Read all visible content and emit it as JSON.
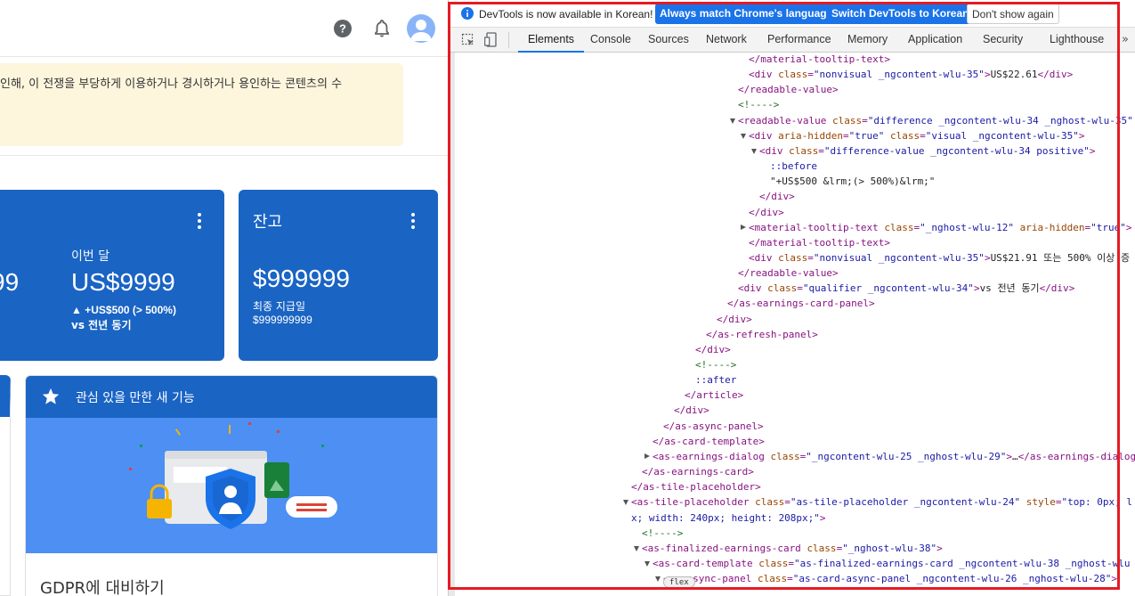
{
  "page": {
    "notice_text": "인해, 이 전쟁을 부당하게 이용하거나 경시하거나 용인하는 콘텐츠의 수",
    "cards": {
      "month": {
        "partial_value": "99",
        "partial_sub": ")",
        "label": "이번 달",
        "value": "US$9999",
        "change": "▲ +US$500 (> 500%)",
        "compare": "vs 전년 동기"
      },
      "balance": {
        "title": "잔고",
        "value": "$999999",
        "paid_label": "최종 지급일",
        "paid_value": "$999999999"
      }
    },
    "feature": {
      "title": "관심 있을 만한 새 기능",
      "subtitle": "GDPR에 대비하기"
    },
    "colors": {
      "card_blue": "#1a64c4",
      "notice_bg": "#fdf6dd",
      "illustration_bg": "#4d8ff2"
    }
  },
  "devtools": {
    "infobar": {
      "text": "DevTools is now available in Korean!",
      "btn_match": "Always match Chrome's language",
      "btn_switch": "Switch DevTools to Korean",
      "btn_dont": "Don't show again"
    },
    "tabs": [
      "Elements",
      "Console",
      "Sources",
      "Network",
      "Performance",
      "Memory",
      "Application",
      "Security",
      "Lighthouse"
    ],
    "active_tab": "Elements",
    "flex_badge": "flex",
    "dom_lines": [
      "</material-tooltip-text>",
      "<div class=\"nonvisual _ngcontent-wlu-35\">US$22.61</div>",
      "</readable-value>",
      "<!---->",
      "<readable-value class=\"difference _ngcontent-wlu-34 _nghost-wlu-35\"",
      "<div aria-hidden=\"true\" class=\"visual _ngcontent-wlu-35\">",
      "<div class=\"difference-value _ngcontent-wlu-34 positive\">",
      "::before",
      "\"+US$500 &lrm;(> 500%)&lrm;\"",
      "</div>",
      "</div>",
      "<material-tooltip-text class=\"_nghost-wlu-12\" aria-hidden=\"true\">",
      "</material-tooltip-text>",
      "<div class=\"nonvisual _ngcontent-wlu-35\">US$21.91 또는 500% 이상 증",
      "</readable-value>",
      "<div class=\"qualifier _ngcontent-wlu-34\">vs 전년 동기</div>",
      "</as-earnings-card-panel>",
      "</div>",
      "</as-refresh-panel>",
      "</div>",
      "<!---->",
      "::after",
      "</article>",
      "</div>",
      "</as-async-panel>",
      "</as-card-template>",
      "<as-earnings-dialog class=\"_ngcontent-wlu-25 _nghost-wlu-29\">…</as-earnings-dialog>",
      "</as-earnings-card>",
      "</as-tile-placeholder>",
      "<as-tile-placeholder class=\"as-tile-placeholder _ngcontent-wlu-24\" style=\"top: 0px; l",
      "x; width: 240px; height: 208px;\">",
      "<!---->",
      "<as-finalized-earnings-card class=\"_nghost-wlu-38\">",
      "<as-card-template class=\"as-finalized-earnings-card _ngcontent-wlu-38 _nghost-wlu",
      "<as-async-panel class=\"as-card-async-panel _ngcontent-wlu-26 _nghost-wlu-28\">"
    ]
  }
}
